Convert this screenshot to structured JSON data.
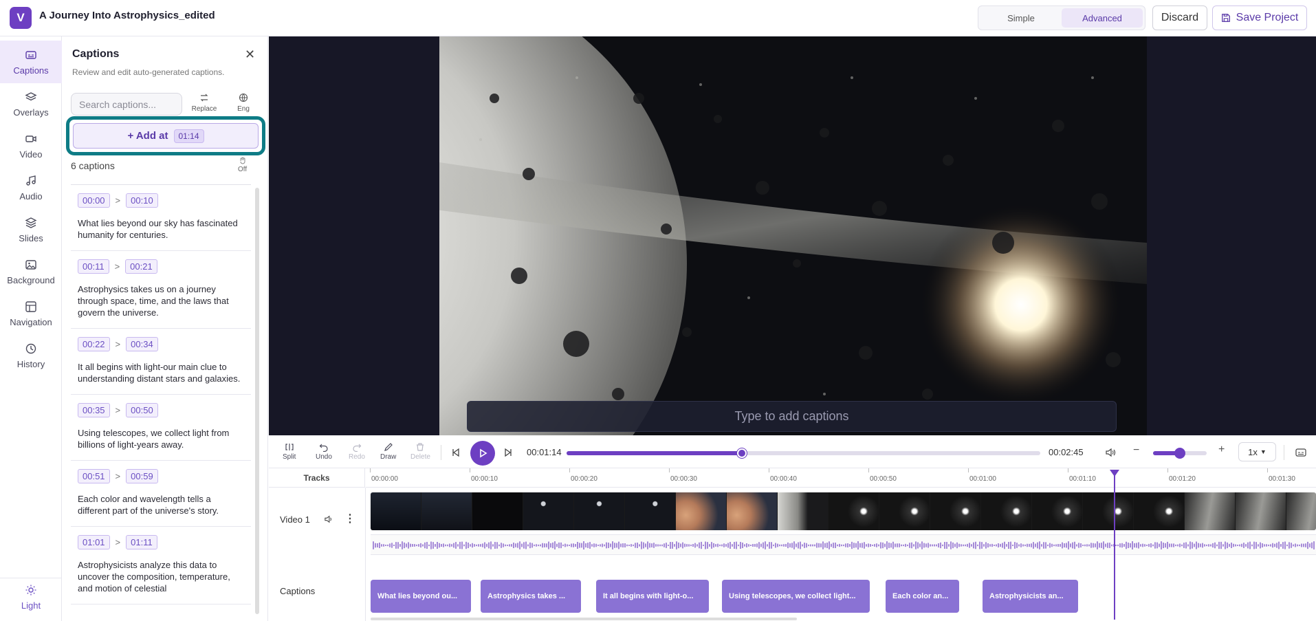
{
  "header": {
    "logo_letter": "V",
    "project_title": "A Journey Into Astrophysics_edited",
    "mode_simple": "Simple",
    "mode_advanced": "Advanced",
    "discard_label": "Discard",
    "save_label": "Save Project"
  },
  "rail": {
    "items": [
      {
        "label": "Captions",
        "icon": "captions-icon",
        "active": true
      },
      {
        "label": "Overlays",
        "icon": "layers-icon"
      },
      {
        "label": "Video",
        "icon": "video-camera-icon"
      },
      {
        "label": "Audio",
        "icon": "music-note-icon"
      },
      {
        "label": "Slides",
        "icon": "stack-icon"
      },
      {
        "label": "Background",
        "icon": "image-icon"
      },
      {
        "label": "Navigation",
        "icon": "layout-icon"
      },
      {
        "label": "History",
        "icon": "history-icon"
      }
    ],
    "theme_label": "Light"
  },
  "panel": {
    "title": "Captions",
    "subtitle": "Review and edit auto-generated captions.",
    "search_placeholder": "Search captions...",
    "replace_label": "Replace",
    "lang_label": "Eng",
    "add_label": "+ Add at",
    "add_time": "01:14",
    "off_label": "Off",
    "count_label": "6 captions",
    "captions": [
      {
        "start": "00:00",
        "end": "00:10",
        "text": "What lies beyond our sky has fascinated humanity for centuries."
      },
      {
        "start": "00:11",
        "end": "00:21",
        "text": "Astrophysics takes us on a journey through space, time, and the laws that govern the universe."
      },
      {
        "start": "00:22",
        "end": "00:34",
        "text": "It all begins with light-our main clue to understanding distant stars and galaxies."
      },
      {
        "start": "00:35",
        "end": "00:50",
        "text": "Using telescopes, we collect light from billions of light-years away."
      },
      {
        "start": "00:51",
        "end": "00:59",
        "text": "Each color and wavelength tells a different part of the universe's story."
      },
      {
        "start": "01:01",
        "end": "01:11",
        "text": "Astrophysicists analyze this data to uncover the composition, temperature, and motion of celestial"
      }
    ]
  },
  "preview": {
    "caption_placeholder": "Type to add captions"
  },
  "controls": {
    "split": "Split",
    "undo": "Undo",
    "redo": "Redo",
    "draw": "Draw",
    "delete": "Delete",
    "current_time": "00:01:14",
    "end_time": "00:02:45",
    "progress": 0.37,
    "volume": 0.5,
    "speed": "1x"
  },
  "timeline": {
    "tracks_label": "Tracks",
    "ticks": [
      "00:00:00",
      "00:00:10",
      "00:00:20",
      "00:00:30",
      "00:00:40",
      "00:00:50",
      "00:01:00",
      "00:01:10",
      "00:01:20",
      "00:01:30"
    ],
    "video_track_label": "Video 1",
    "captions_track_label": "Captions",
    "caption_blocks": [
      "What lies beyond ou...",
      "Astrophysics takes ...",
      "It all begins with light-o...",
      "Using telescopes, we collect light...",
      "Each color an...",
      "Astrophysicists an..."
    ]
  },
  "colors": {
    "accent": "#6d3fc2",
    "highlight_border": "#0e7c86",
    "caption_block": "#8a72d4"
  }
}
